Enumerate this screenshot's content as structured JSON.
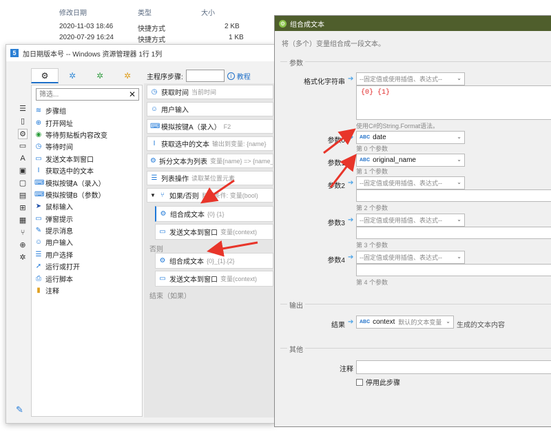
{
  "explorer": {
    "headers": [
      "修改日期",
      "类型",
      "大小"
    ],
    "rows": [
      {
        "date": "2020-11-03 18:46",
        "type": "快捷方式",
        "size": "2 KB"
      },
      {
        "date": "2020-07-29 16:24",
        "type": "快捷方式",
        "size": "1 KB"
      }
    ]
  },
  "main": {
    "title": "加日期版本号 -- Windows 资源管理器 1行 1列",
    "logo": "5",
    "left_tabs": [
      "settings-icon",
      "cogs-green-icon",
      "cogs-green-icon",
      "cogs-yellow-icon"
    ],
    "side_icons": [
      "list-icon",
      "bookmark-icon",
      "gear-icon",
      "window-icon",
      "text-icon",
      "image-icon",
      "clipboard-icon",
      "document-icon",
      "windows-icon",
      "grid-icon",
      "branch-icon",
      "globe-icon",
      "cogs-icon"
    ],
    "filter_placeholder": "筛选...",
    "tools": [
      "步骤组",
      "打开网址",
      "等待剪贴板内容改变",
      "等待时间",
      "发送文本到窗口",
      "获取选中的文本",
      "模拟按键A（录入）",
      "模拟按键B（参数）",
      "鼠标输入",
      "弹窗提示",
      "提示消息",
      "用户输入",
      "用户选择",
      "运行或打开",
      "运行脚本",
      "注释"
    ],
    "main_steps_label": "主程序步骤:",
    "help_label": "教程",
    "steps": [
      {
        "label": "获取时间",
        "hint": "当前时间"
      },
      {
        "label": "用户输入",
        "hint": ""
      },
      {
        "label": "模拟按键A（录入）",
        "hint": "F2"
      },
      {
        "label": "获取选中的文本",
        "hint": "输出到变量: {name}"
      },
      {
        "label": "拆分文本为列表",
        "hint": "变量{name} => {name_"
      },
      {
        "label": "列表操作",
        "hint": "读取某位置元素"
      },
      {
        "label": "如果/否则",
        "hint": "判断条件: 变量(bool)"
      },
      {
        "label": "组合成文本",
        "hint": "{0} {1}"
      },
      {
        "label": "发送文本到窗口",
        "hint": "变量(context)"
      },
      {
        "label": "组合成文本",
        "hint": "{0}_{1}.{2}"
      },
      {
        "label": "发送文本到窗口",
        "hint": "变量(context)"
      }
    ],
    "else_label": "否则",
    "end_label": "结束（如果）"
  },
  "dialog": {
    "title": "组合成文本",
    "description": "将（多个）变量组合成一段文本。",
    "params_group": "参数",
    "format_label": "格式化字符串",
    "format_dropdown": "--固定值或使用插值、表达式--",
    "format_value": "{0} {1}",
    "format_note": "使用C#的String.Format语法。",
    "params": [
      {
        "label": "参数0",
        "value": "date",
        "typed": true,
        "note": "第 0 个参数"
      },
      {
        "label": "参数1",
        "value": "original_name",
        "typed": true,
        "note": "第 1 个参数"
      },
      {
        "label": "参数2",
        "value": "--固定值或使用插值、表达式--",
        "typed": false,
        "note": "第 2 个参数"
      },
      {
        "label": "参数3",
        "value": "--固定值或使用插值、表达式--",
        "typed": false,
        "note": "第 3 个参数"
      },
      {
        "label": "参数4",
        "value": "--固定值或使用插值、表达式--",
        "typed": false,
        "note": "第 4 个参数"
      }
    ],
    "type_badge": "ABC",
    "output_group": "输出",
    "result_label": "结果",
    "result_value": "context",
    "result_hint": "默认的文本变量",
    "result_note": "生成的文本内容",
    "other_group": "其他",
    "comment_label": "注释",
    "disable_label": "停用此步骤"
  },
  "colors": {
    "dialog_title_bg": "#4f5e2c",
    "accent": "#1e78d8",
    "annotation_arrow": "#e8352a",
    "format_text": "#e02828"
  }
}
